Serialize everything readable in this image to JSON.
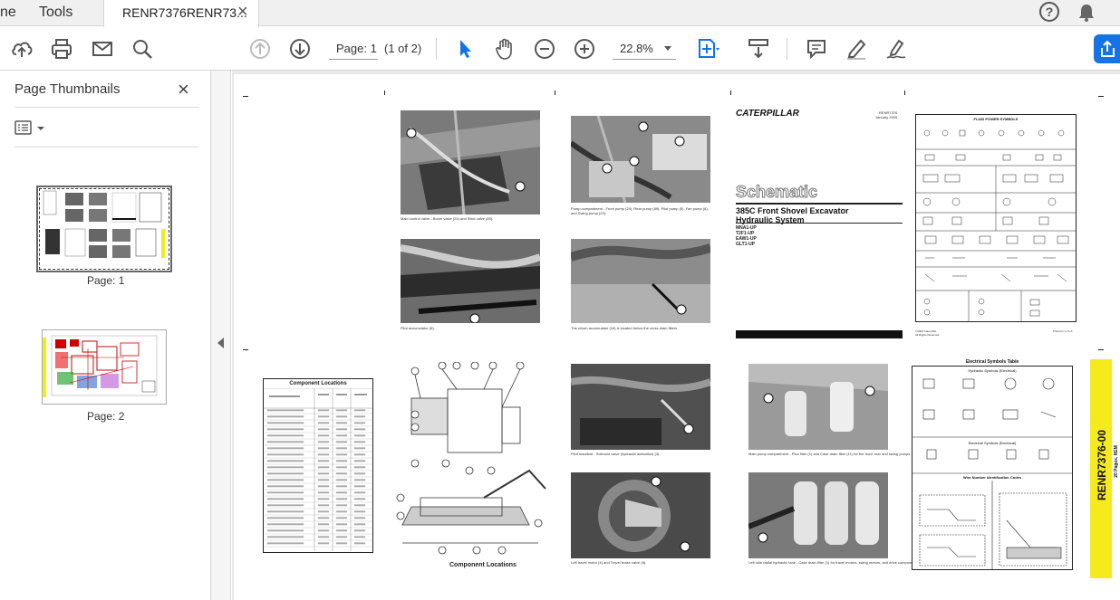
{
  "tabs": {
    "home": "ne",
    "tools": "Tools",
    "document": "RENR7376RENR73...",
    "close": "×"
  },
  "toolbar": {
    "page_label": "Page: 1",
    "page_count": "(1 of 2)",
    "zoom": "22.8%"
  },
  "panel": {
    "title": "Page Thumbnails",
    "close": "×",
    "thumbnails": [
      {
        "label": "Page: 1"
      },
      {
        "label": "Page: 2"
      }
    ]
  },
  "document": {
    "logo": "CATERPILLAR",
    "doc_id": "RENR7376",
    "doc_date": "January 2009",
    "schematic": "Schematic",
    "model": "385C Front Shovel Excavator",
    "system": "Hydraulic System",
    "serials": [
      "MNA1-UP",
      "T2F1-UP",
      "EAW1-UP",
      "GLT1-UP"
    ],
    "copyright": "©2009 Caterpillar",
    "rights": "All Rights Reserved",
    "printed": "Printed in U.S.A.",
    "fluid_symbols_title": "FLUID POWER SYMBOLS",
    "electrical_symbols_title": "Electrical Symbols Table",
    "hydraulic_sub": "Hydraulic Symbols (Electrical)",
    "electrical_sub": "Electrical Symbols (Electrical)",
    "wire_title": "Wire Number Identification Codes",
    "component_locations_title": "Component Locations",
    "component_locations_label": "Component Locations",
    "side_tab": "RENR7376-00",
    "side_tab_sub": "20 Pages, REM",
    "captions": [
      "Main control valve - Boom valve (24) and Stick valve (89).",
      "Pump compartment - Front pump (24), Rear pump (89), Pilot pump (5), Fan pump (6), and Swing pump (23).",
      "Pilot accumulator (6).",
      "The return accumulator (16) is located below the cross drain filters.",
      "Pilot manifold - Solenoid valve (hydraulic activation) (3).",
      "Main pump compartment - Pilot filter (1) and Case drain filter (11) for the front, rear and swing pumps.",
      "Left travel motor (4) and Travel brake valve (6).",
      "Left side radial hydraulic tank - Case drain filter (1) for travel motors, swing motors, and drive components."
    ]
  }
}
